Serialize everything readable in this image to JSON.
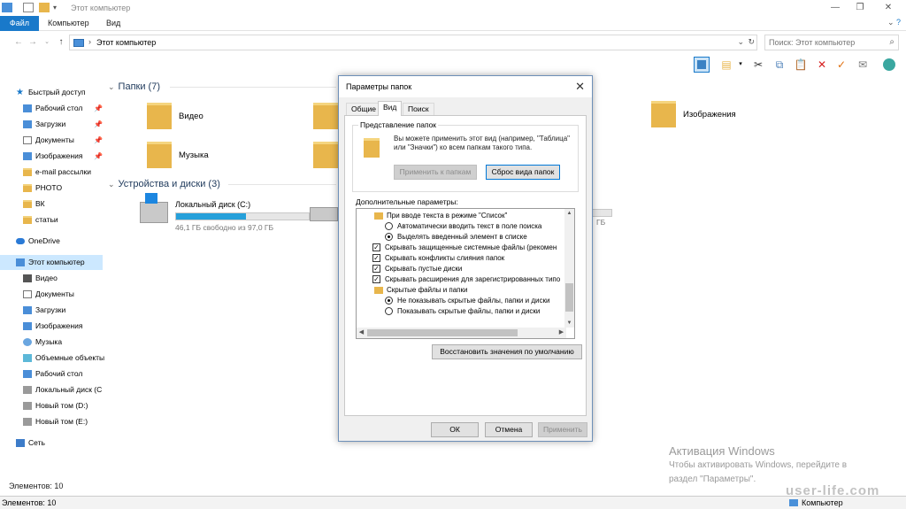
{
  "window": {
    "title": "Этот компьютер",
    "controls": [
      "—",
      "❐",
      "✕"
    ]
  },
  "ribbon": {
    "file_tab": "Файл",
    "tabs": [
      "Компьютер",
      "Вид"
    ]
  },
  "address": {
    "crumb": "Этот компьютер",
    "separator": "›"
  },
  "search": {
    "placeholder": "Поиск: Этот компьютер"
  },
  "nav": {
    "quick_access": "Быстрый доступ",
    "quick_items": [
      "Рабочий стол",
      "Загрузки",
      "Документы",
      "Изображения",
      "e-mail рассылки",
      "PHOTO",
      "ВК",
      "статьи"
    ],
    "onedrive": "OneDrive",
    "this_pc": "Этот компьютер",
    "pc_items": [
      "Видео",
      "Документы",
      "Загрузки",
      "Изображения",
      "Музыка",
      "Объемные объекты",
      "Рабочий стол",
      "Локальный диск (C",
      "Новый том (D:)",
      "Новый том (E:)"
    ],
    "network": "Сеть"
  },
  "content": {
    "folders_header": "Папки (7)",
    "folders": [
      "Видео",
      "Музыка",
      "Изображения"
    ],
    "drives_header": "Устройства и диски (3)",
    "drive_c": {
      "name": "Локальный диск (C:)",
      "free": "46,1 ГБ свободно из 97,0 ГБ",
      "used_fraction": 0.525
    },
    "drive2_free_partial": "ГБ"
  },
  "status": {
    "items_count_1": "Элементов: 10",
    "items_count_2": "Элементов: 10",
    "location": "Компьютер"
  },
  "activation": {
    "heading": "Активация Windows",
    "line1": "Чтобы активировать Windows, перейдите в",
    "line2": "раздел \"Параметры\"."
  },
  "watermark": "user-life.com",
  "dialog": {
    "title": "Параметры папок",
    "tabs": [
      "Общие",
      "Вид",
      "Поиск"
    ],
    "folder_views_label": "Представление папок",
    "folder_views_text": "Вы можете применить этот вид (например, \"Таблица\" или \"Значки\") ко всем папкам такого типа.",
    "apply_to_folders": "Применить к папкам",
    "reset_folders": "Сброс вида папок",
    "advanced_label": "Дополнительные параметры:",
    "tree": [
      {
        "kind": "folder",
        "text": "При вводе текста в режиме \"Список\""
      },
      {
        "kind": "radio",
        "checked": false,
        "text": "Автоматически вводить текст в поле поиска"
      },
      {
        "kind": "radio",
        "checked": true,
        "text": "Выделять введенный элемент в списке"
      },
      {
        "kind": "check",
        "checked": true,
        "text": "Скрывать защищенные системные файлы (рекомен"
      },
      {
        "kind": "check",
        "checked": true,
        "text": "Скрывать конфликты слияния папок"
      },
      {
        "kind": "check",
        "checked": true,
        "text": "Скрывать пустые диски"
      },
      {
        "kind": "check",
        "checked": true,
        "text": "Скрывать расширения для зарегистрированных типо"
      },
      {
        "kind": "folder",
        "text": "Скрытые файлы и папки"
      },
      {
        "kind": "radio",
        "checked": true,
        "text": "Не показывать скрытые файлы, папки и диски"
      },
      {
        "kind": "radio",
        "checked": false,
        "text": "Показывать скрытые файлы, папки и диски"
      }
    ],
    "restore_defaults": "Восстановить значения по умолчанию",
    "ok": "ОК",
    "cancel": "Отмена",
    "apply": "Применить"
  }
}
